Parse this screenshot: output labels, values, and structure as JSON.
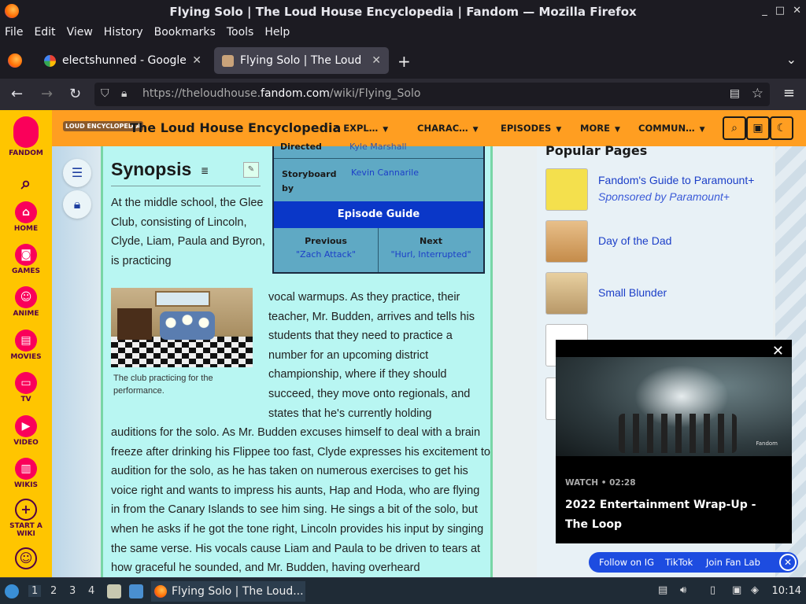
{
  "window": {
    "title": "Flying Solo | The Loud House Encyclopedia | Fandom — Mozilla Firefox",
    "controls": [
      "_",
      "□",
      "✕"
    ]
  },
  "menubar": [
    "File",
    "Edit",
    "View",
    "History",
    "Bookmarks",
    "Tools",
    "Help"
  ],
  "tabs": [
    {
      "label": "electshunned - Google Se",
      "close": "✕"
    },
    {
      "label": "Flying Solo | The Loud Ho",
      "close": "✕"
    }
  ],
  "newtab": "+",
  "tablist": "⌄",
  "nav": {
    "back": "←",
    "forward": "→",
    "reload": "↻",
    "url_pre": "https://theloudhouse.",
    "url_host": "fandom.com",
    "url_path": "/wiki/Flying_Solo",
    "menu": "≡"
  },
  "fandom_rail": [
    {
      "label": "FANDOM",
      "icon": "fandom-logo-icon"
    },
    {
      "label": "",
      "icon": "search-icon",
      "glyph": "⌕"
    },
    {
      "label": "HOME",
      "icon": "home-icon",
      "glyph": "⌂"
    },
    {
      "label": "GAMES",
      "icon": "games-icon",
      "glyph": "◙"
    },
    {
      "label": "ANIME",
      "icon": "anime-icon",
      "glyph": "☺"
    },
    {
      "label": "MOVIES",
      "icon": "movies-icon",
      "glyph": "▤"
    },
    {
      "label": "TV",
      "icon": "tv-icon",
      "glyph": "▭"
    },
    {
      "label": "VIDEO",
      "icon": "video-icon",
      "glyph": "▶"
    },
    {
      "label": "WIKIS",
      "icon": "wikis-icon",
      "glyph": "▥"
    },
    {
      "label": "START A WIKI",
      "icon": "plus-icon",
      "glyph": "+"
    },
    {
      "label": "",
      "icon": "user-icon",
      "glyph": "☺"
    }
  ],
  "wikibar": {
    "logo": "LOUD ENCYCLOPEDIA",
    "name": "The Loud House Encyclopedia",
    "nav": [
      "EXPL…",
      "CHARAC…",
      "EPISODES",
      "MORE",
      "COMMUN…"
    ],
    "buttons": [
      "⌕",
      "▣",
      "☾"
    ]
  },
  "article": {
    "heading": "Synopsis",
    "para1": "At the middle school, the Glee Club, consisting of Lincoln, Clyde, Liam, Paula and Byron, is practicing",
    "para2": "vocal warmups. As they practice, their teacher, Mr. Budden, arrives and tells his students that they need to practice a number for an upcoming district championship, where if they should succeed, they move onto regionals, and states that he's currently holding",
    "para3": "auditions for the solo. As Mr. Budden excuses himself to deal with a brain freeze after drinking his Flippee too fast, Clyde expresses his excitement to audition for the solo, as he has taken on numerous exercises to get his voice right and wants to impress his aunts, Hap and Hoda, who are flying in from the Canary Islands to see him sing. He sings a bit of the solo, but when he asks if he got the tone right, Lincoln provides his input by singing the same verse. His vocals cause Liam and Paula to be driven to tears at how graceful he sounded, and Mr. Budden, having overheard",
    "caption": "The club practicing for the performance."
  },
  "infobox": {
    "cut_label": "Directed",
    "cut_value": "Kyle Marshall",
    "storyboard_label": "Storyboard by",
    "storyboard_value": "Kevin Cannarile",
    "guide": "Episode Guide",
    "previous_label": "Previous",
    "previous_value": "\"Zach Attack\"",
    "next_label": "Next",
    "next_value": "\"Hurl, Interrupted\""
  },
  "popular": {
    "heading": "Popular Pages",
    "items": [
      {
        "title": "Fandom's Guide to Paramount+",
        "sub": "Sponsored by Paramount+"
      },
      {
        "title": "Day of the Dad",
        "sub": ""
      },
      {
        "title": "Small Blunder",
        "sub": ""
      }
    ]
  },
  "video": {
    "watch": "WATCH • 02:28",
    "title": "2022 Entertainment Wrap-Up - The Loop",
    "brand": "Fandom",
    "close": "✕"
  },
  "social": [
    "Follow on IG",
    "TikTok",
    "Join Fan Lab"
  ],
  "taskbar": {
    "workspaces": [
      "1",
      "2",
      "3",
      "4"
    ],
    "app": "Flying Solo | The Loud...",
    "clock": "10:14"
  }
}
